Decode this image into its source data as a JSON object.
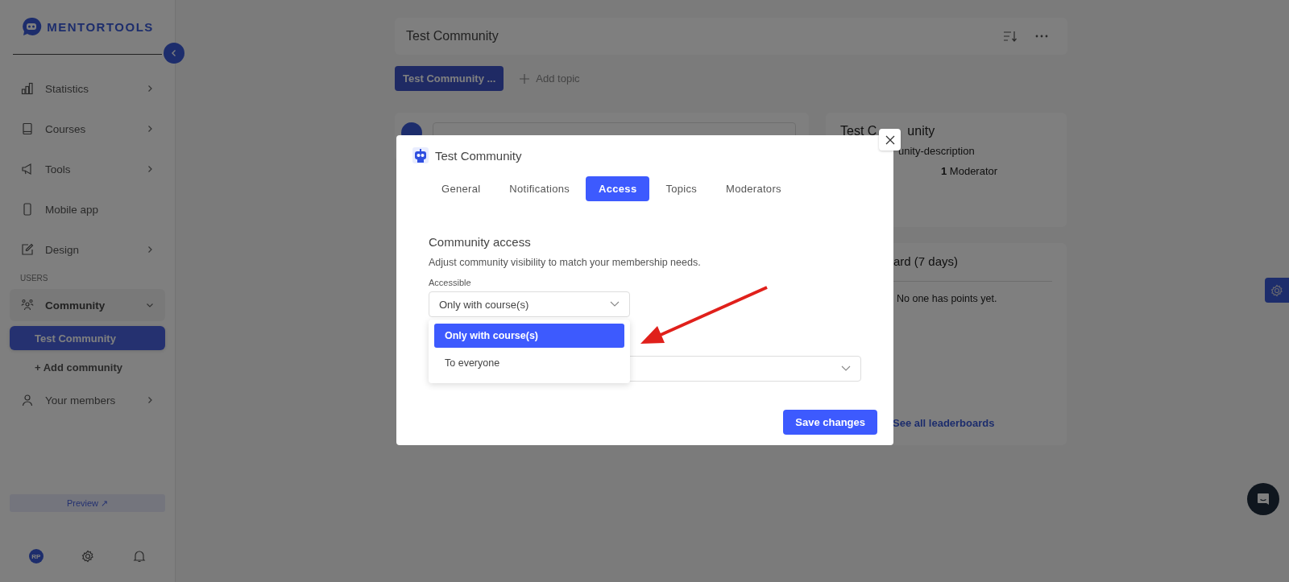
{
  "sidebar": {
    "brand": "MENTORTOOLS",
    "sections": [
      {
        "items": [
          {
            "label": "Statistics",
            "submenu": true,
            "expanded": false
          },
          {
            "label": "Courses",
            "submenu": true,
            "expanded": false
          },
          {
            "label": "Tools",
            "submenu": true,
            "expanded": false
          },
          {
            "label": "Mobile app",
            "submenu": false,
            "expanded": false
          },
          {
            "label": "Design",
            "submenu": true,
            "expanded": false
          }
        ]
      },
      {
        "title": "USERS",
        "items": [
          {
            "label": "Community",
            "submenu": true,
            "expanded": true,
            "children": [
              {
                "label": "Test Community",
                "selected": true
              },
              {
                "label": "+ Add community",
                "selected": false
              }
            ]
          },
          {
            "label": "Your members",
            "submenu": true,
            "expanded": false
          }
        ]
      }
    ],
    "preview_button": "Preview ↗",
    "avatar": "RP"
  },
  "header": {
    "title": "Test Community"
  },
  "topics": [
    {
      "label": "Test Community ...",
      "selected": true
    }
  ],
  "add_topic": "Add topic",
  "community_card": {
    "title_parts": [
      "Test C",
      "unity"
    ],
    "description": "unity-description",
    "moderators": "**1** Moderator"
  },
  "leaderboard": {
    "title": "ard (7 days)",
    "empty": "No one has points yet.",
    "link": "See all leaderboards"
  },
  "modal": {
    "title": "Test Community",
    "tabs": [
      {
        "label": "General",
        "selected": false
      },
      {
        "label": "Notifications",
        "selected": false
      },
      {
        "label": "Access",
        "selected": true
      },
      {
        "label": "Topics",
        "selected": false
      },
      {
        "label": "Moderators",
        "selected": false
      }
    ],
    "section_title": "Community access",
    "description": "Adjust community visibility to match your membership needs.",
    "field_label": "Accessible",
    "select_value": "Only with course(s)",
    "dropdown_open": true,
    "options": [
      {
        "label": "Only with course(s)",
        "selected": true
      },
      {
        "label": "To everyone",
        "selected": false
      }
    ],
    "save_button": "Save changes"
  }
}
